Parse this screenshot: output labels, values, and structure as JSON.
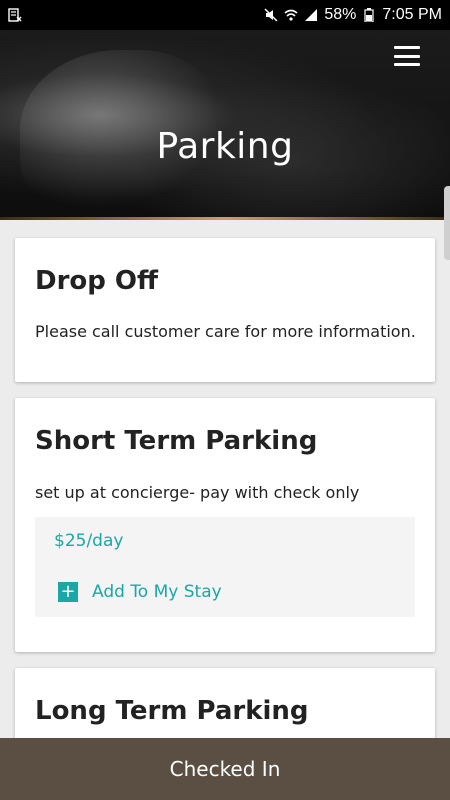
{
  "status_bar": {
    "battery": "58%",
    "time": "7:05 PM"
  },
  "header": {
    "title": "Parking",
    "menu_icon": "hamburger-menu-icon"
  },
  "cards": [
    {
      "title": "Drop Off",
      "text": "Please call customer care for more information."
    },
    {
      "title": "Short Term Parking",
      "text": "set up at concierge- pay with check only",
      "price": "$25/day",
      "action_label": "Add To My Stay"
    },
    {
      "title": "Long Term Parking"
    }
  ],
  "footer": {
    "label": "Checked In"
  },
  "colors": {
    "accent": "#1aa7a5",
    "footer_bg": "#5a4f42"
  }
}
